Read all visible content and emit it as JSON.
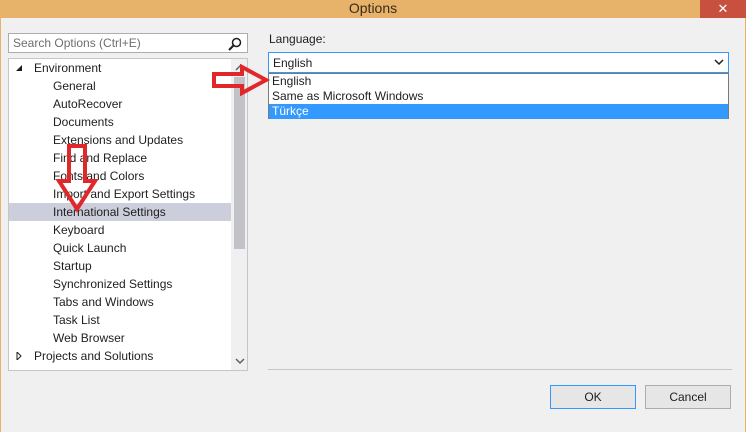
{
  "window": {
    "title": "Options",
    "close_glyph": "✕"
  },
  "search": {
    "placeholder": "Search Options (Ctrl+E)",
    "icon": "search-icon"
  },
  "tree": {
    "items": [
      {
        "label": "Environment",
        "level": 0,
        "expanded": true
      },
      {
        "label": "General",
        "level": 1
      },
      {
        "label": "AutoRecover",
        "level": 1
      },
      {
        "label": "Documents",
        "level": 1
      },
      {
        "label": "Extensions and Updates",
        "level": 1
      },
      {
        "label": "Find and Replace",
        "level": 1
      },
      {
        "label": "Fonts and Colors",
        "level": 1
      },
      {
        "label": "Import and Export Settings",
        "level": 1
      },
      {
        "label": "International Settings",
        "level": 1,
        "selected": true
      },
      {
        "label": "Keyboard",
        "level": 1
      },
      {
        "label": "Quick Launch",
        "level": 1
      },
      {
        "label": "Startup",
        "level": 1
      },
      {
        "label": "Synchronized Settings",
        "level": 1
      },
      {
        "label": "Tabs and Windows",
        "level": 1
      },
      {
        "label": "Task List",
        "level": 1
      },
      {
        "label": "Web Browser",
        "level": 1
      },
      {
        "label": "Projects and Solutions",
        "level": 0,
        "expanded": false
      }
    ]
  },
  "language": {
    "label": "Language:",
    "selected": "English",
    "options": [
      "English",
      "Same as Microsoft Windows",
      "Türkçe"
    ],
    "highlighted_option": "Türkçe"
  },
  "buttons": {
    "ok": "OK",
    "cancel": "Cancel"
  },
  "colors": {
    "titlebar": "#e7b26a",
    "close": "#c7503f",
    "selection": "#cccedb",
    "highlight": "#3399ff",
    "annotation_arrow": "#e0282b"
  }
}
